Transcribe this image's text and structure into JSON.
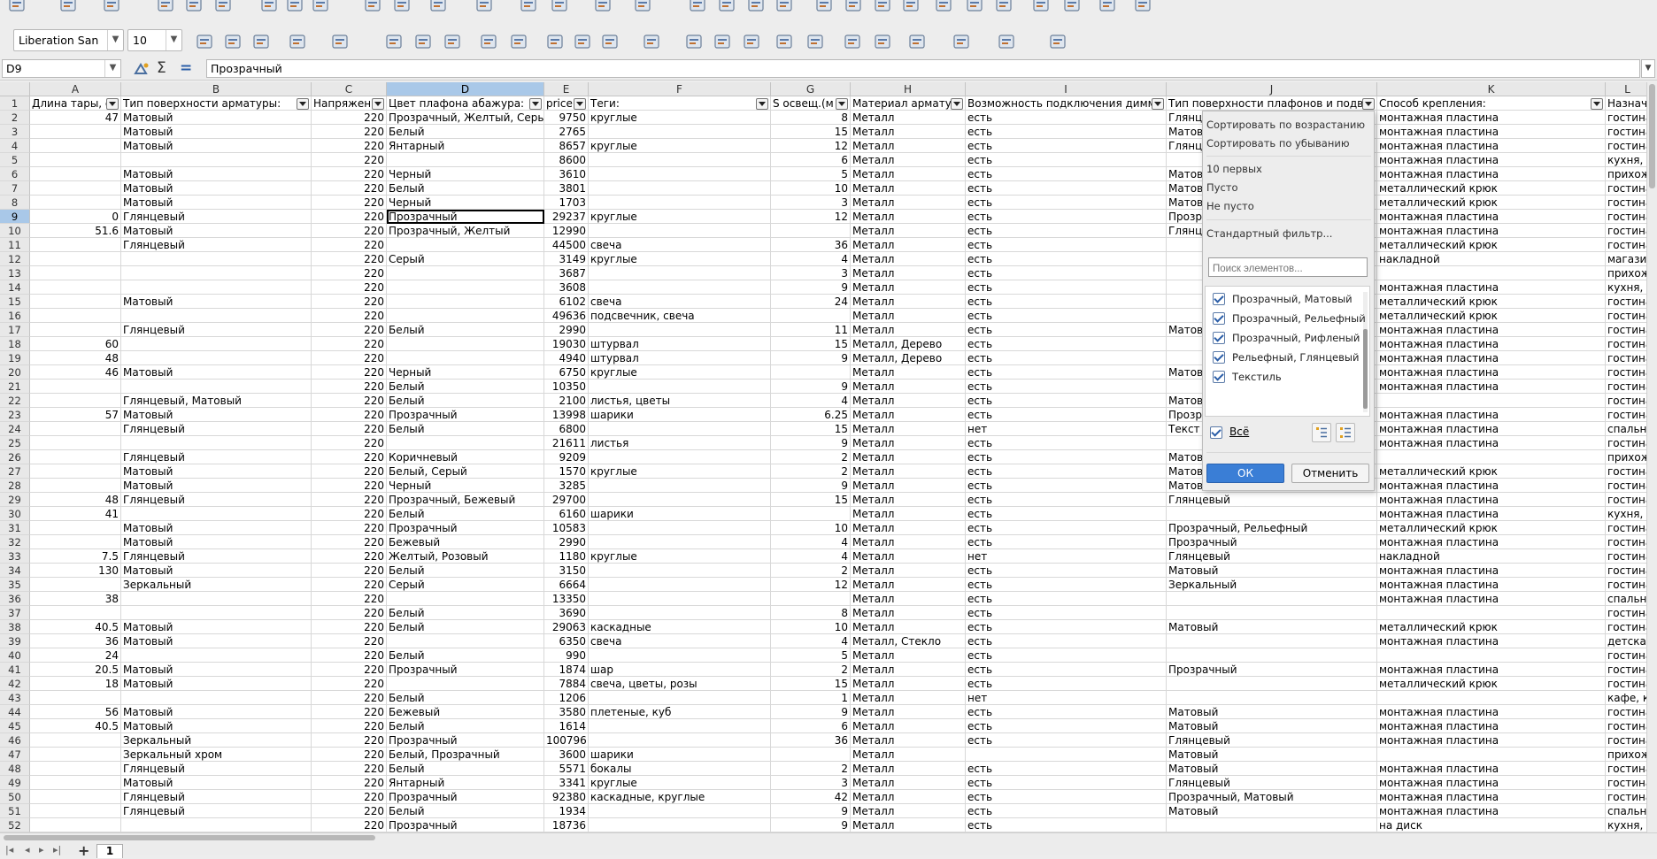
{
  "toolbar": {
    "font_name": "Liberation San",
    "font_size": "10"
  },
  "formula_bar": {
    "cell_ref": "D9",
    "sum_symbol": "Σ",
    "equals_symbol": "=",
    "content": "Прозрачный"
  },
  "columns": [
    {
      "letter": "A",
      "header": "Длина тары, с"
    },
    {
      "letter": "B",
      "header": "Тип поверхности арматуры:"
    },
    {
      "letter": "C",
      "header": "Напряжени"
    },
    {
      "letter": "D",
      "header": "Цвет плафона абажура:"
    },
    {
      "letter": "E",
      "header": "price"
    },
    {
      "letter": "F",
      "header": "Теги:"
    },
    {
      "letter": "G",
      "header": "S освещ.(м"
    },
    {
      "letter": "H",
      "header": "Материал арматур"
    },
    {
      "letter": "I",
      "header": "Возможность подключения димме"
    },
    {
      "letter": "J",
      "header": "Тип поверхности плафонов и подве"
    },
    {
      "letter": "K",
      "header": "Способ крепления:"
    },
    {
      "letter": "L",
      "header": "Назнач"
    }
  ],
  "rows": [
    {
      "n": "2",
      "a": "47",
      "b": "Матовый",
      "c": "220",
      "d": "Прозрачный, Желтый, Серый",
      "e": "9750",
      "f": "круглые",
      "g": "8",
      "h": "Металл",
      "i": "есть",
      "j": "Глянц",
      "k": "монтажная пластина",
      "l": "гостина"
    },
    {
      "n": "3",
      "a": "",
      "b": "Матовый",
      "c": "220",
      "d": "Белый",
      "e": "2765",
      "f": "",
      "g": "15",
      "h": "Металл",
      "i": "есть",
      "j": "Матов",
      "k": "монтажная пластина",
      "l": "гостина"
    },
    {
      "n": "4",
      "a": "",
      "b": "Матовый",
      "c": "220",
      "d": "Янтарный",
      "e": "8657",
      "f": "круглые",
      "g": "12",
      "h": "Металл",
      "i": "есть",
      "j": "Глянц",
      "k": "монтажная пластина",
      "l": "гостина"
    },
    {
      "n": "5",
      "a": "",
      "b": "",
      "c": "220",
      "d": "",
      "e": "8600",
      "f": "",
      "g": "6",
      "h": "Металл",
      "i": "есть",
      "j": "",
      "k": "монтажная пластина",
      "l": "кухня,"
    },
    {
      "n": "6",
      "a": "",
      "b": "Матовый",
      "c": "220",
      "d": "Черный",
      "e": "3610",
      "f": "",
      "g": "5",
      "h": "Металл",
      "i": "есть",
      "j": "Матов",
      "k": "монтажная пластина",
      "l": "прихож"
    },
    {
      "n": "7",
      "a": "",
      "b": "Матовый",
      "c": "220",
      "d": "Белый",
      "e": "3801",
      "f": "",
      "g": "10",
      "h": "Металл",
      "i": "есть",
      "j": "Матов",
      "k": "металлический крюк",
      "l": "гостина"
    },
    {
      "n": "8",
      "a": "",
      "b": "Матовый",
      "c": "220",
      "d": "Черный",
      "e": "1703",
      "f": "",
      "g": "3",
      "h": "Металл",
      "i": "есть",
      "j": "Матов",
      "k": "металлический крюк",
      "l": "гостина"
    },
    {
      "n": "9",
      "a": "0",
      "b": "Глянцевый",
      "c": "220",
      "d": "Прозрачный",
      "e": "29237",
      "f": "круглые",
      "g": "12",
      "h": "Металл",
      "i": "есть",
      "j": "Прозр",
      "k": "монтажная пластина",
      "l": "гостина"
    },
    {
      "n": "10",
      "a": "51.6",
      "b": "Матовый",
      "c": "220",
      "d": "Прозрачный, Желтый",
      "e": "12990",
      "f": "",
      "g": "",
      "h": "Металл",
      "i": "есть",
      "j": "Глянц",
      "k": "монтажная пластина",
      "l": "гостина"
    },
    {
      "n": "11",
      "a": "",
      "b": "Глянцевый",
      "c": "220",
      "d": "",
      "e": "44500",
      "f": "свеча",
      "g": "36",
      "h": "Металл",
      "i": "есть",
      "j": "",
      "k": "металлический крюк",
      "l": "гостина"
    },
    {
      "n": "12",
      "a": "",
      "b": "",
      "c": "220",
      "d": "Серый",
      "e": "3149",
      "f": "круглые",
      "g": "4",
      "h": "Металл",
      "i": "есть",
      "j": "",
      "k": "накладной",
      "l": "магазин"
    },
    {
      "n": "13",
      "a": "",
      "b": "",
      "c": "220",
      "d": "",
      "e": "3687",
      "f": "",
      "g": "3",
      "h": "Металл",
      "i": "есть",
      "j": "",
      "k": "",
      "l": "прихож"
    },
    {
      "n": "14",
      "a": "",
      "b": "",
      "c": "220",
      "d": "",
      "e": "3608",
      "f": "",
      "g": "9",
      "h": "Металл",
      "i": "есть",
      "j": "",
      "k": "монтажная пластина",
      "l": "кухня, п"
    },
    {
      "n": "15",
      "a": "",
      "b": "Матовый",
      "c": "220",
      "d": "",
      "e": "6102",
      "f": "свеча",
      "g": "24",
      "h": "Металл",
      "i": "есть",
      "j": "",
      "k": "металлический крюк",
      "l": "гостина"
    },
    {
      "n": "16",
      "a": "",
      "b": "",
      "c": "220",
      "d": "",
      "e": "49636",
      "f": "подсвечник, свеча",
      "g": "",
      "h": "Металл",
      "i": "есть",
      "j": "",
      "k": "металлический крюк",
      "l": "гостина"
    },
    {
      "n": "17",
      "a": "",
      "b": "Глянцевый",
      "c": "220",
      "d": "Белый",
      "e": "2990",
      "f": "",
      "g": "11",
      "h": "Металл",
      "i": "есть",
      "j": "Матов",
      "k": "монтажная пластина",
      "l": "гостина"
    },
    {
      "n": "18",
      "a": "60",
      "b": "",
      "c": "220",
      "d": "",
      "e": "19030",
      "f": "штурвал",
      "g": "15",
      "h": "Металл, Дерево",
      "i": "есть",
      "j": "",
      "k": "монтажная пластина",
      "l": "гостина"
    },
    {
      "n": "19",
      "a": "48",
      "b": "",
      "c": "220",
      "d": "",
      "e": "4940",
      "f": "штурвал",
      "g": "9",
      "h": "Металл, Дерево",
      "i": "есть",
      "j": "",
      "k": "монтажная пластина",
      "l": "гостина"
    },
    {
      "n": "20",
      "a": "46",
      "b": "Матовый",
      "c": "220",
      "d": "Черный",
      "e": "6750",
      "f": "круглые",
      "g": "",
      "h": "Металл",
      "i": "есть",
      "j": "Матов",
      "k": "монтажная пластина",
      "l": "гостина"
    },
    {
      "n": "21",
      "a": "",
      "b": "",
      "c": "220",
      "d": "Белый",
      "e": "10350",
      "f": "",
      "g": "9",
      "h": "Металл",
      "i": "есть",
      "j": "",
      "k": "монтажная пластина",
      "l": "гостина"
    },
    {
      "n": "22",
      "a": "",
      "b": "Глянцевый, Матовый",
      "c": "220",
      "d": "Белый",
      "e": "2100",
      "f": "листья, цветы",
      "g": "4",
      "h": "Металл",
      "i": "есть",
      "j": "Матов",
      "k": "",
      "l": "гостина"
    },
    {
      "n": "23",
      "a": "57",
      "b": "Матовый",
      "c": "220",
      "d": "Прозрачный",
      "e": "13998",
      "f": "шарики",
      "g": "6.25",
      "h": "Металл",
      "i": "есть",
      "j": "Прозр",
      "k": "монтажная пластина",
      "l": "гостина"
    },
    {
      "n": "24",
      "a": "",
      "b": "Глянцевый",
      "c": "220",
      "d": "Белый",
      "e": "6800",
      "f": "",
      "g": "15",
      "h": "Металл",
      "i": "нет",
      "j": "Текст",
      "k": "монтажная пластина",
      "l": "спальн"
    },
    {
      "n": "25",
      "a": "",
      "b": "",
      "c": "220",
      "d": "",
      "e": "21611",
      "f": "листья",
      "g": "9",
      "h": "Металл",
      "i": "есть",
      "j": "",
      "k": "монтажная пластина",
      "l": "гостина"
    },
    {
      "n": "26",
      "a": "",
      "b": "Глянцевый",
      "c": "220",
      "d": "Коричневый",
      "e": "9209",
      "f": "",
      "g": "2",
      "h": "Металл",
      "i": "есть",
      "j": "Матов",
      "k": "",
      "l": "прихож"
    },
    {
      "n": "27",
      "a": "",
      "b": "Матовый",
      "c": "220",
      "d": "Белый, Серый",
      "e": "1570",
      "f": "круглые",
      "g": "2",
      "h": "Металл",
      "i": "есть",
      "j": "Матов",
      "k": "металлический крюк",
      "l": "гостина"
    },
    {
      "n": "28",
      "a": "",
      "b": "Матовый",
      "c": "220",
      "d": "Черный",
      "e": "3285",
      "f": "",
      "g": "9",
      "h": "Металл",
      "i": "есть",
      "j": "Матов",
      "k": "монтажная пластина",
      "l": "гостина"
    },
    {
      "n": "29",
      "a": "48",
      "b": "Глянцевый",
      "c": "220",
      "d": "Прозрачный, Бежевый",
      "e": "29700",
      "f": "",
      "g": "15",
      "h": "Металл",
      "i": "есть",
      "j": "Глянцевый",
      "k": "монтажная пластина",
      "l": "гостина"
    },
    {
      "n": "30",
      "a": "41",
      "b": "",
      "c": "220",
      "d": "Белый",
      "e": "6160",
      "f": "шарики",
      "g": "",
      "h": "Металл",
      "i": "есть",
      "j": "",
      "k": "монтажная пластина",
      "l": "кухня,"
    },
    {
      "n": "31",
      "a": "",
      "b": "Матовый",
      "c": "220",
      "d": "Прозрачный",
      "e": "10583",
      "f": "",
      "g": "10",
      "h": "Металл",
      "i": "есть",
      "j": "Прозрачный, Рельефный",
      "k": "металлический крюк",
      "l": "гостина"
    },
    {
      "n": "32",
      "a": "",
      "b": "Матовый",
      "c": "220",
      "d": "Бежевый",
      "e": "2990",
      "f": "",
      "g": "4",
      "h": "Металл",
      "i": "есть",
      "j": "Прозрачный",
      "k": "монтажная пластина",
      "l": "гостина"
    },
    {
      "n": "33",
      "a": "7.5",
      "b": "Глянцевый",
      "c": "220",
      "d": "Желтый, Розовый",
      "e": "1180",
      "f": "круглые",
      "g": "4",
      "h": "Металл",
      "i": "нет",
      "j": "Глянцевый",
      "k": "накладной",
      "l": "гостина"
    },
    {
      "n": "34",
      "a": "130",
      "b": "Матовый",
      "c": "220",
      "d": "Белый",
      "e": "3150",
      "f": "",
      "g": "2",
      "h": "Металл",
      "i": "есть",
      "j": "Матовый",
      "k": "монтажная пластина",
      "l": "гостина"
    },
    {
      "n": "35",
      "a": "",
      "b": "Зеркальный",
      "c": "220",
      "d": "Серый",
      "e": "6664",
      "f": "",
      "g": "12",
      "h": "Металл",
      "i": "есть",
      "j": "Зеркальный",
      "k": "монтажная пластина",
      "l": "гостина"
    },
    {
      "n": "36",
      "a": "38",
      "b": "",
      "c": "220",
      "d": "",
      "e": "13350",
      "f": "",
      "g": "",
      "h": "Металл",
      "i": "есть",
      "j": "",
      "k": "монтажная пластина",
      "l": "спальн"
    },
    {
      "n": "37",
      "a": "",
      "b": "",
      "c": "220",
      "d": "Белый",
      "e": "3690",
      "f": "",
      "g": "8",
      "h": "Металл",
      "i": "есть",
      "j": "",
      "k": "",
      "l": "гостина"
    },
    {
      "n": "38",
      "a": "40.5",
      "b": "Матовый",
      "c": "220",
      "d": "Белый",
      "e": "29063",
      "f": "каскадные",
      "g": "10",
      "h": "Металл",
      "i": "есть",
      "j": "Матовый",
      "k": "металлический крюк",
      "l": "гостина"
    },
    {
      "n": "39",
      "a": "36",
      "b": "Матовый",
      "c": "220",
      "d": "",
      "e": "6350",
      "f": "свеча",
      "g": "4",
      "h": "Металл, Стекло",
      "i": "есть",
      "j": "",
      "k": "монтажная пластина",
      "l": "детская"
    },
    {
      "n": "40",
      "a": "24",
      "b": "",
      "c": "220",
      "d": "Белый",
      "e": "990",
      "f": "",
      "g": "5",
      "h": "Металл",
      "i": "есть",
      "j": "",
      "k": "",
      "l": "гостина"
    },
    {
      "n": "41",
      "a": "20.5",
      "b": "Матовый",
      "c": "220",
      "d": "Прозрачный",
      "e": "1874",
      "f": "шар",
      "g": "2",
      "h": "Металл",
      "i": "есть",
      "j": "Прозрачный",
      "k": "монтажная пластина",
      "l": "гостина"
    },
    {
      "n": "42",
      "a": "18",
      "b": "Матовый",
      "c": "220",
      "d": "",
      "e": "7884",
      "f": "свеча, цветы, розы",
      "g": "15",
      "h": "Металл",
      "i": "есть",
      "j": "",
      "k": "металлический крюк",
      "l": "гостина"
    },
    {
      "n": "43",
      "a": "",
      "b": "",
      "c": "220",
      "d": "Белый",
      "e": "1206",
      "f": "",
      "g": "1",
      "h": "Металл",
      "i": "нет",
      "j": "",
      "k": "",
      "l": "кафе, к"
    },
    {
      "n": "44",
      "a": "56",
      "b": "Матовый",
      "c": "220",
      "d": "Бежевый",
      "e": "3580",
      "f": "плетеные, куб",
      "g": "9",
      "h": "Металл",
      "i": "есть",
      "j": "Матовый",
      "k": "монтажная пластина",
      "l": "гостина"
    },
    {
      "n": "45",
      "a": "40.5",
      "b": "Матовый",
      "c": "220",
      "d": "Белый",
      "e": "1614",
      "f": "",
      "g": "6",
      "h": "Металл",
      "i": "есть",
      "j": "Матовый",
      "k": "монтажная пластина",
      "l": "гостина"
    },
    {
      "n": "46",
      "a": "",
      "b": "Зеркальный",
      "c": "220",
      "d": "Прозрачный",
      "e": "100796",
      "f": "",
      "g": "36",
      "h": "Металл",
      "i": "есть",
      "j": "Глянцевый",
      "k": "монтажная пластина",
      "l": "гостина"
    },
    {
      "n": "47",
      "a": "",
      "b": "Зеркальный хром",
      "c": "220",
      "d": "Белый, Прозрачный",
      "e": "3600",
      "f": "шарики",
      "g": "",
      "h": "Металл",
      "i": "",
      "j": "Матовый",
      "k": "",
      "l": "прихож"
    },
    {
      "n": "48",
      "a": "",
      "b": "Глянцевый",
      "c": "220",
      "d": "Белый",
      "e": "5571",
      "f": "бокалы",
      "g": "2",
      "h": "Металл",
      "i": "есть",
      "j": "Матовый",
      "k": "монтажная пластина",
      "l": "гостина"
    },
    {
      "n": "49",
      "a": "",
      "b": "Матовый",
      "c": "220",
      "d": "Янтарный",
      "e": "3341",
      "f": "круглые",
      "g": "3",
      "h": "Металл",
      "i": "есть",
      "j": "Глянцевый",
      "k": "монтажная пластина",
      "l": "гостина"
    },
    {
      "n": "50",
      "a": "",
      "b": "Глянцевый",
      "c": "220",
      "d": "Прозрачный",
      "e": "92380",
      "f": "каскадные, круглые",
      "g": "42",
      "h": "Металл",
      "i": "есть",
      "j": "Прозрачный, Матовый",
      "k": "монтажная пластина",
      "l": "гостина"
    },
    {
      "n": "51",
      "a": "",
      "b": "Глянцевый",
      "c": "220",
      "d": "Белый",
      "e": "1934",
      "f": "",
      "g": "9",
      "h": "Металл",
      "i": "есть",
      "j": "Матовый",
      "k": "монтажная пластина",
      "l": "спальн"
    },
    {
      "n": "52",
      "a": "",
      "b": "",
      "c": "220",
      "d": "Прозрачный",
      "e": "18736",
      "f": "",
      "g": "9",
      "h": "Металл",
      "i": "есть",
      "j": "",
      "k": "на диск",
      "l": "кухня,"
    }
  ],
  "filter_popup": {
    "sort_asc": "Сортировать по возрастанию",
    "sort_desc": "Сортировать по убыванию",
    "top10": "10 первых",
    "empty": "Пусто",
    "not_empty": "Не пусто",
    "standard_filter": "Стандартный фильтр...",
    "search_placeholder": "Поиск элементов...",
    "items": [
      "Прозрачный, Матовый",
      "Прозрачный, Рельефный",
      "Прозрачный, Рифленый",
      "Рельефный, Глянцевый",
      "Текстиль"
    ],
    "all_label": "Всё",
    "ok": "ОК",
    "cancel": "Отменить"
  },
  "sheet_tab": "1",
  "colors": {
    "selection": "#a9c8e8",
    "ok_button": "#3a7ed6"
  }
}
